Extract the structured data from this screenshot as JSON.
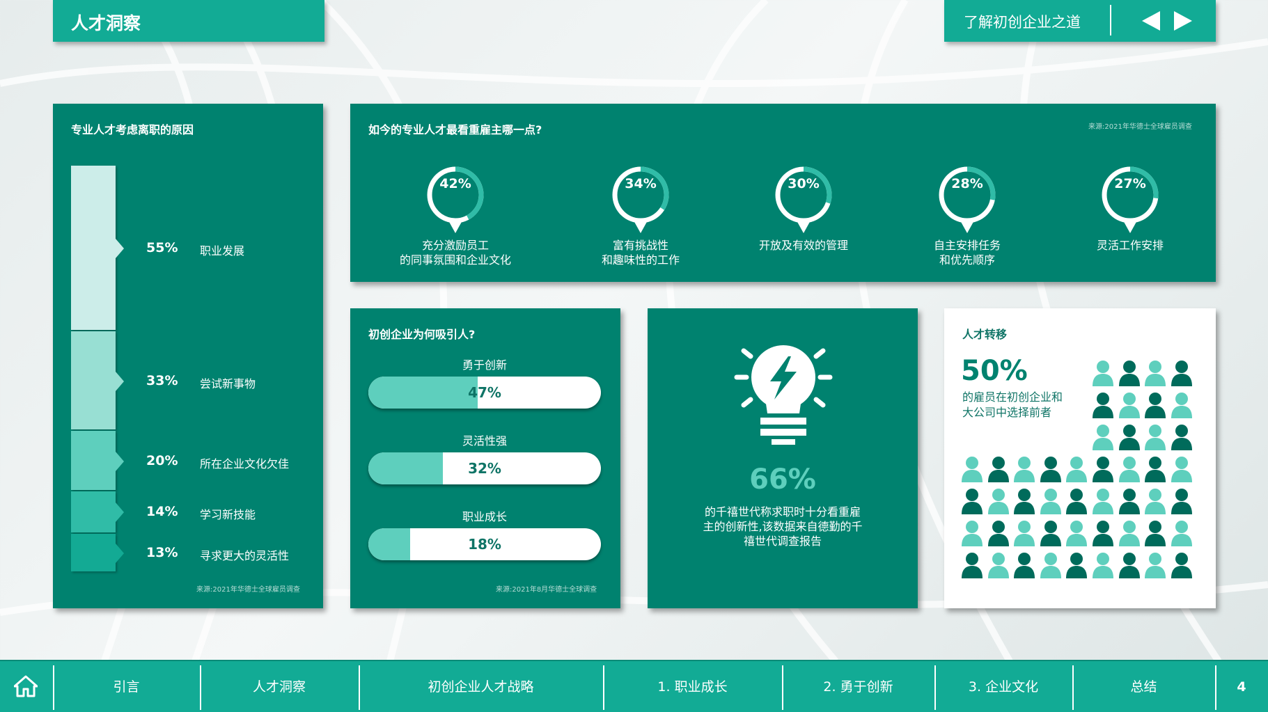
{
  "header": {
    "title": "人才洞察"
  },
  "top_nav": {
    "label": "了解初创企业之道"
  },
  "leave_reasons": {
    "title": "专业人才考虑离职的原因",
    "source": "来源:2021年华德士全球雇员调查",
    "items": [
      {
        "percent": "55%",
        "value": 55,
        "label": "职业发展",
        "color": "#ccede9"
      },
      {
        "percent": "33%",
        "value": 33,
        "label": "尝试新事物",
        "color": "#98dfd3"
      },
      {
        "percent": "20%",
        "value": 20,
        "label": "所在企业文化欠佳",
        "color": "#5ecfbd"
      },
      {
        "percent": "14%",
        "value": 14,
        "label": "学习新技能",
        "color": "#30bca7"
      },
      {
        "percent": "13%",
        "value": 13,
        "label": "寻求更大的灵活性",
        "color": "#13aa94"
      }
    ]
  },
  "employer_values": {
    "title": "如今的专业人才最看重雇主哪一点?",
    "source": "来源:2021年华德士全球雇员调查",
    "items": [
      {
        "percent": "42%",
        "value": 42,
        "line1": "充分激励员工",
        "line2": "的同事氛围和企业文化"
      },
      {
        "percent": "34%",
        "value": 34,
        "line1": "富有挑战性",
        "line2": "和趣味性的工作"
      },
      {
        "percent": "30%",
        "value": 30,
        "line1": "开放及有效的管理",
        "line2": ""
      },
      {
        "percent": "28%",
        "value": 28,
        "line1": "自主安排任务",
        "line2": "和优先顺序"
      },
      {
        "percent": "27%",
        "value": 27,
        "line1": "灵活工作安排",
        "line2": ""
      }
    ]
  },
  "startup_attraction": {
    "title": "初创企业为何吸引人?",
    "source": "来源:2021年8月华德士全球调查",
    "items": [
      {
        "label": "勇于创新",
        "percent": "47%",
        "value": 47
      },
      {
        "label": "灵活性强",
        "percent": "32%",
        "value": 32
      },
      {
        "label": "职业成长",
        "percent": "18%",
        "value": 18
      }
    ]
  },
  "millennials": {
    "percent": "66%",
    "line1": "的千禧世代称求职时十分看重雇",
    "line2": "主的创新性,该数据来自德勤的千",
    "line3": "禧世代调查报告"
  },
  "talent_shift": {
    "title": "人才转移",
    "percent": "50%",
    "line1": "的雇员在初创企业和",
    "line2": "大公司中选择前者"
  },
  "bottom_nav": {
    "items": [
      "引言",
      "人才洞察",
      "初创企业人才战略",
      "1. 职业成长",
      "2. 勇于创新",
      "3. 企业文化",
      "总结"
    ],
    "page": "4"
  },
  "colors": {
    "card": "#00826f",
    "accent": "#12ab95",
    "light": "#5ecfbd",
    "dark_person": "#006b5b"
  },
  "icons": [
    "home-icon",
    "prev-arrow-icon",
    "next-arrow-icon",
    "lightbulb-icon",
    "person-icon"
  ]
}
